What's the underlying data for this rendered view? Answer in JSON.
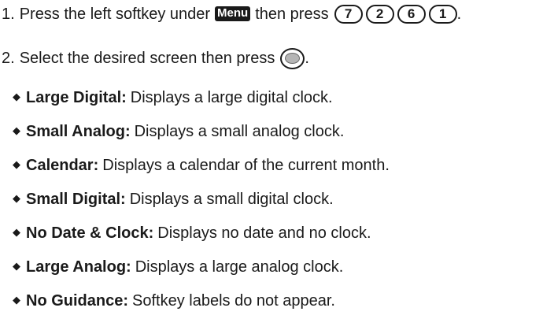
{
  "steps": [
    {
      "number": "1.",
      "text_before": "Press the left softkey under",
      "menu_label": "Menu",
      "text_after": "then press",
      "keys": [
        "7",
        "2",
        "6",
        "1"
      ],
      "end": "."
    },
    {
      "number": "2.",
      "text_before": "Select the desired screen then press",
      "end": "."
    }
  ],
  "options": [
    {
      "term": "Large Digital:",
      "description": "Displays a large digital clock."
    },
    {
      "term": "Small Analog:",
      "description": "Displays a small analog clock."
    },
    {
      "term": "Calendar:",
      "description": "Displays a calendar of the current month."
    },
    {
      "term": "Small Digital:",
      "description": "Displays a small digital clock."
    },
    {
      "term": "No Date & Clock:",
      "description": "Displays no date and no clock."
    },
    {
      "term": "Large Analog:",
      "description": "Displays a large analog clock."
    },
    {
      "term": "No Guidance:",
      "description": "Softkey labels do not appear."
    }
  ],
  "icons": {
    "bullet": "diamond-bullet-icon",
    "ok_key": "ok-key-icon"
  }
}
